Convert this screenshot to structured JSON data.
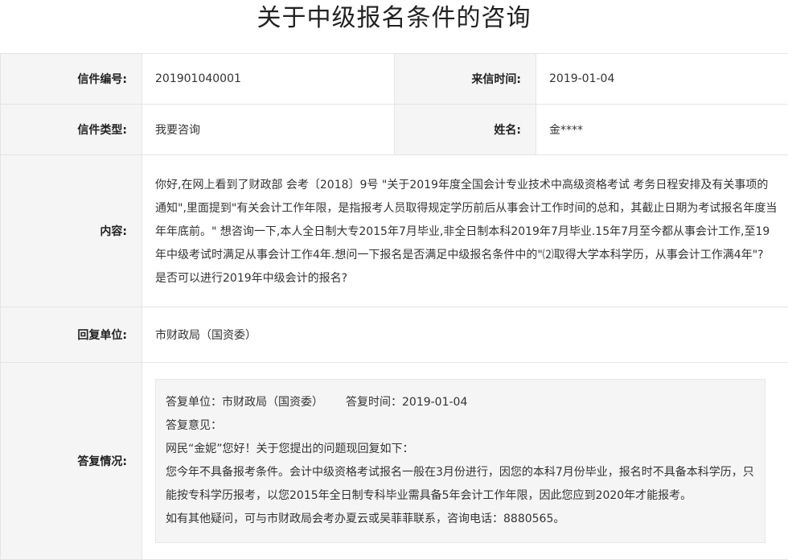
{
  "page_title": "关于中级报名条件的咨询",
  "fields": {
    "letter_no_label": "信件编号:",
    "letter_no": "201901040001",
    "date_label": "来信时间:",
    "date": "2019-01-04",
    "type_label": "信件类型:",
    "type": "我要咨询",
    "name_label": "姓名:",
    "name": "金****",
    "content_label": "内容:",
    "content": "你好,在网上看到了财政部 会考〔2018〕9号 \"关于2019年度全国会计专业技术中高级资格考试 考务日程安排及有关事项的通知\",里面提到\"有关会计工作年限，是指报考人员取得规定学历前后从事会计工作时间的总和，其截止日期为考试报名年度当年年底前。\" 想咨询一下,本人全日制大专2015年7月毕业,非全日制本科2019年7月毕业.15年7月至今都从事会计工作,至19年中级考试时满足从事会计工作4年.想问一下报名是否满足中级报名条件中的\"⑵取得大学本科学历，从事会计工作满4年\"? 是否可以进行2019年中级会计的报名?",
    "unit_label": "回复单位:",
    "unit": "市财政局（国资委）",
    "reply_label": "答复情况:"
  },
  "reply": {
    "unit_line": "答复单位：市财政局（国资委）",
    "time_line": "答复时间：2019-01-04",
    "opinion_label": "答复意见：",
    "greeting": "网民“金妮”您好！关于您提出的问题现回复如下：",
    "body": "您今年不具备报考条件。会计中级资格考试报名一般在3月份进行，因您的本科7月份毕业，报名时不具备本科学历，只能按专科学历报考，以您2015年全日制专科毕业需具备5年会计工作年限，因此您应到2020年才能报考。",
    "contact": "如有其他疑问，可与市财政局会考办夏云或吴菲菲联系，咨询电话：8880565。"
  }
}
